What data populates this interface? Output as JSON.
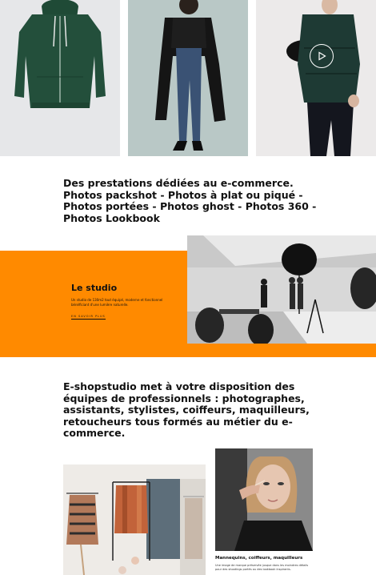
{
  "intro": {
    "text": "Des prestations dédiées au e-commerce. Photos packshot - Photos à plat ou piqué - Photos portées - Photos ghost - Photos 360 - Photos Lookbook"
  },
  "studio": {
    "title": "Le studio",
    "description": "Un studio de 130m2 tout équipé, moderne et fonctionnel bénéficiant d'une lumière naturelle.",
    "link_label": "EN SAVOIR PLUS"
  },
  "team": {
    "text": "E-shopstudio met à votre disposition des équipes de professionnels : photographes, assistants, stylistes, coiffeurs, maquilleurs, retoucheurs tous formés au métier du e-commerce."
  },
  "makeup_card": {
    "caption": "Mannequins, coiffeurs, maquilleurs",
    "description": "Une image de marque préservée jusque dans les moindres détails pour des shootings portés ou des lookbook inspirants."
  },
  "colors": {
    "accent_orange": "#ff8a00",
    "text_dark": "#111111"
  },
  "icons": {
    "play": "play-icon"
  }
}
